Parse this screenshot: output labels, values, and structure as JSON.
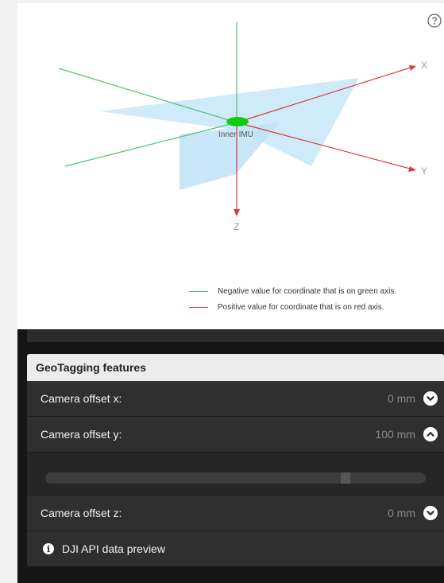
{
  "diagram": {
    "imu_label": "Inner IMU",
    "axes": {
      "x": "X",
      "y": "Y",
      "z": "Z"
    },
    "help_icon": "question-circle-icon",
    "colors": {
      "negative": "#4fc27a",
      "positive": "#d93a3a",
      "plane": "#bfe3f7",
      "imu": "#12cc12"
    }
  },
  "legend": [
    {
      "text": "Negative value for coordinate that is on green axis.",
      "color": "#4fc27a"
    },
    {
      "text": "Positive value for coordinate that is on red axis.",
      "color": "#d93a3a"
    }
  ],
  "geotagging": {
    "title": "GeoTagging features",
    "offset_x": {
      "label": "Camera offset x:",
      "value": "0 mm",
      "icon": "chevron-down-icon"
    },
    "offset_y": {
      "label": "Camera offset y:",
      "value": "100 mm",
      "icon": "chevron-up-icon",
      "slider_fraction": 0.79
    },
    "offset_z": {
      "label": "Camera offset z:",
      "value": "0 mm",
      "icon": "chevron-down-icon"
    },
    "dji_preview": {
      "label": "DJI API data preview",
      "icon": "info-icon"
    }
  }
}
